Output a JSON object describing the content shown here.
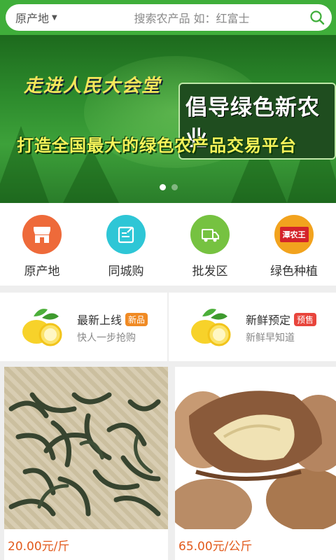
{
  "header": {
    "origin_label": "原产地",
    "search_placeholder": "搜索农产品 如：红富士"
  },
  "banner": {
    "script_text": "走进人民大会堂",
    "headline": "倡导绿色新农业",
    "subline": "打造全国最大的绿色农产品交易平台",
    "slide_count": 2,
    "active_slide": 1
  },
  "categories": [
    {
      "label": "原产地",
      "icon": "storefront-icon",
      "color": "#ee6a3a"
    },
    {
      "label": "同城购",
      "icon": "edit-note-icon",
      "color": "#2ec6d6"
    },
    {
      "label": "批发区",
      "icon": "delivery-truck-icon",
      "color": "#76c241"
    },
    {
      "label": "绿色种植",
      "icon": "brand-logo-icon",
      "color": "#f2a31e",
      "logo_text": "潭农王"
    }
  ],
  "promos": [
    {
      "title": "最新上线",
      "badge": "新品",
      "badge_color": "#f08a24",
      "subtitle": "快人一步抢购"
    },
    {
      "title": "新鲜预定",
      "badge": "预售",
      "badge_color": "#e8453c",
      "subtitle": "新鲜早知道"
    }
  ],
  "products": [
    {
      "price": "20.00元/斤",
      "image": "dried-tea-leaves"
    },
    {
      "price": "65.00元/公斤",
      "image": "roasted-nuts"
    }
  ],
  "colors": {
    "brand_green": "#3fae3a",
    "price_orange": "#e25a1c"
  }
}
